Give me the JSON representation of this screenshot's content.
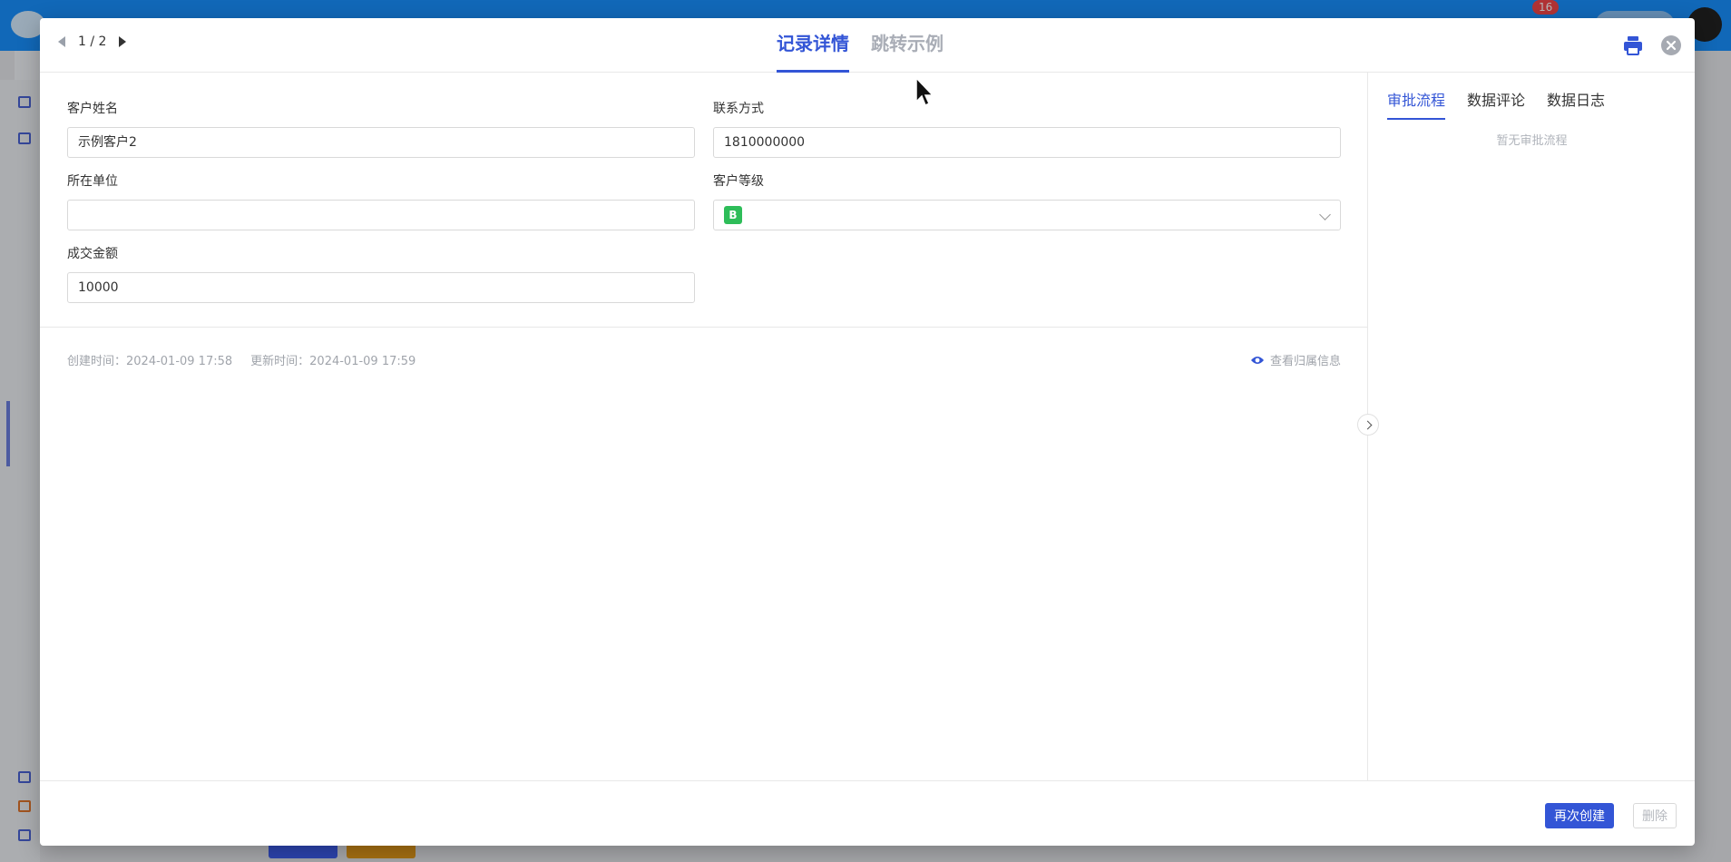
{
  "modal": {
    "pager": {
      "current": "1 / 2"
    },
    "tabs": [
      {
        "label": "记录详情",
        "active": true
      },
      {
        "label": "跳转示例",
        "active": false
      }
    ]
  },
  "form": {
    "fields": [
      {
        "label": "客户姓名",
        "value": "示例客户2"
      },
      {
        "label": "联系方式",
        "value": "1810000000"
      },
      {
        "label": "所在单位",
        "value": ""
      },
      {
        "label": "客户等级",
        "value": "B"
      },
      {
        "label": "成交金额",
        "value": "10000"
      }
    ]
  },
  "meta": {
    "created": "创建时间：2024-01-09 17:58",
    "updated": "更新时间：2024-01-09 17:59",
    "view_owner": "查看归属信息"
  },
  "side_panel": {
    "tabs": [
      {
        "label": "审批流程",
        "active": true
      },
      {
        "label": "数据评论",
        "active": false
      },
      {
        "label": "数据日志",
        "active": false
      }
    ],
    "empty_text": "暂无审批流程"
  },
  "footer": {
    "recreate_label": "再次创建",
    "delete_label": "删除"
  },
  "background": {
    "notification_count": "16"
  },
  "colors": {
    "accent": "#3355d6",
    "grade_b": "#2ebd59",
    "topbar": "#1890ff"
  },
  "icons": [
    "prev-arrow-icon",
    "next-arrow-icon",
    "print-icon",
    "close-icon",
    "eye-icon",
    "chevron-down-icon",
    "chevron-right-icon"
  ]
}
